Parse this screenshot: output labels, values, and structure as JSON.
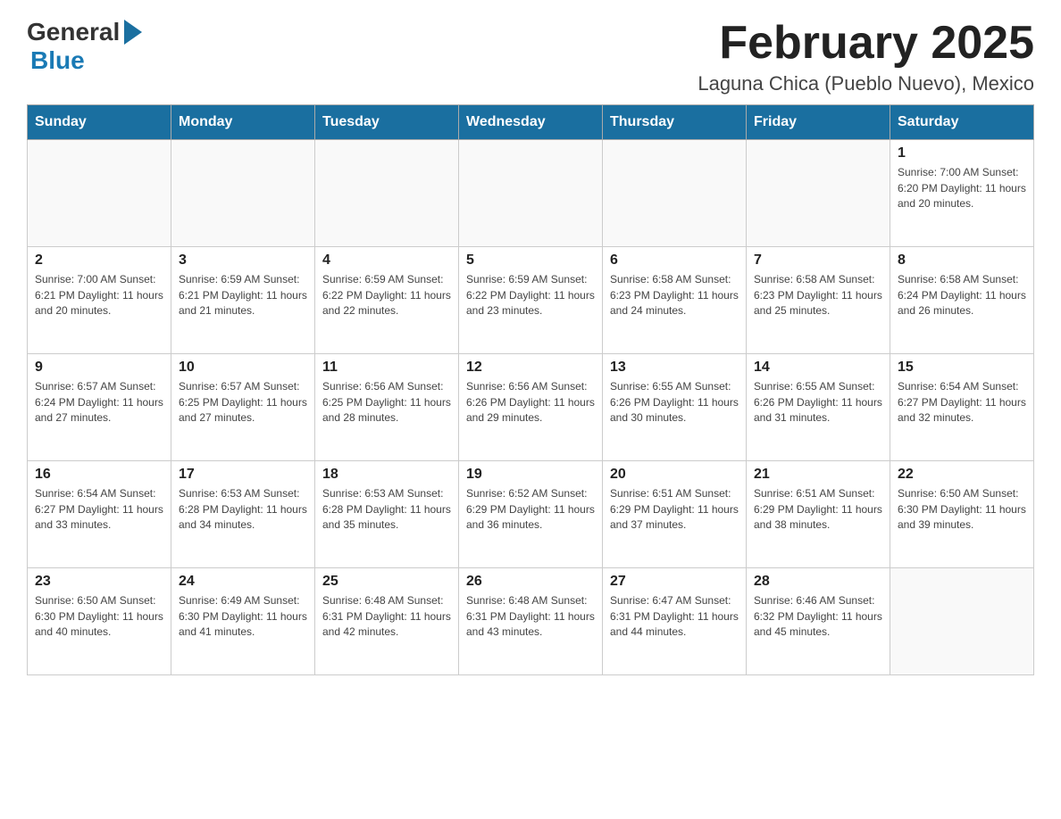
{
  "header": {
    "logo_general": "General",
    "logo_blue": "Blue",
    "month_title": "February 2025",
    "location": "Laguna Chica (Pueblo Nuevo), Mexico"
  },
  "weekdays": [
    "Sunday",
    "Monday",
    "Tuesday",
    "Wednesday",
    "Thursday",
    "Friday",
    "Saturday"
  ],
  "weeks": [
    {
      "days": [
        {
          "number": "",
          "info": "",
          "empty": true
        },
        {
          "number": "",
          "info": "",
          "empty": true
        },
        {
          "number": "",
          "info": "",
          "empty": true
        },
        {
          "number": "",
          "info": "",
          "empty": true
        },
        {
          "number": "",
          "info": "",
          "empty": true
        },
        {
          "number": "",
          "info": "",
          "empty": true
        },
        {
          "number": "1",
          "info": "Sunrise: 7:00 AM\nSunset: 6:20 PM\nDaylight: 11 hours and 20 minutes."
        }
      ]
    },
    {
      "days": [
        {
          "number": "2",
          "info": "Sunrise: 7:00 AM\nSunset: 6:21 PM\nDaylight: 11 hours and 20 minutes."
        },
        {
          "number": "3",
          "info": "Sunrise: 6:59 AM\nSunset: 6:21 PM\nDaylight: 11 hours and 21 minutes."
        },
        {
          "number": "4",
          "info": "Sunrise: 6:59 AM\nSunset: 6:22 PM\nDaylight: 11 hours and 22 minutes."
        },
        {
          "number": "5",
          "info": "Sunrise: 6:59 AM\nSunset: 6:22 PM\nDaylight: 11 hours and 23 minutes."
        },
        {
          "number": "6",
          "info": "Sunrise: 6:58 AM\nSunset: 6:23 PM\nDaylight: 11 hours and 24 minutes."
        },
        {
          "number": "7",
          "info": "Sunrise: 6:58 AM\nSunset: 6:23 PM\nDaylight: 11 hours and 25 minutes."
        },
        {
          "number": "8",
          "info": "Sunrise: 6:58 AM\nSunset: 6:24 PM\nDaylight: 11 hours and 26 minutes."
        }
      ]
    },
    {
      "days": [
        {
          "number": "9",
          "info": "Sunrise: 6:57 AM\nSunset: 6:24 PM\nDaylight: 11 hours and 27 minutes."
        },
        {
          "number": "10",
          "info": "Sunrise: 6:57 AM\nSunset: 6:25 PM\nDaylight: 11 hours and 27 minutes."
        },
        {
          "number": "11",
          "info": "Sunrise: 6:56 AM\nSunset: 6:25 PM\nDaylight: 11 hours and 28 minutes."
        },
        {
          "number": "12",
          "info": "Sunrise: 6:56 AM\nSunset: 6:26 PM\nDaylight: 11 hours and 29 minutes."
        },
        {
          "number": "13",
          "info": "Sunrise: 6:55 AM\nSunset: 6:26 PM\nDaylight: 11 hours and 30 minutes."
        },
        {
          "number": "14",
          "info": "Sunrise: 6:55 AM\nSunset: 6:26 PM\nDaylight: 11 hours and 31 minutes."
        },
        {
          "number": "15",
          "info": "Sunrise: 6:54 AM\nSunset: 6:27 PM\nDaylight: 11 hours and 32 minutes."
        }
      ]
    },
    {
      "days": [
        {
          "number": "16",
          "info": "Sunrise: 6:54 AM\nSunset: 6:27 PM\nDaylight: 11 hours and 33 minutes."
        },
        {
          "number": "17",
          "info": "Sunrise: 6:53 AM\nSunset: 6:28 PM\nDaylight: 11 hours and 34 minutes."
        },
        {
          "number": "18",
          "info": "Sunrise: 6:53 AM\nSunset: 6:28 PM\nDaylight: 11 hours and 35 minutes."
        },
        {
          "number": "19",
          "info": "Sunrise: 6:52 AM\nSunset: 6:29 PM\nDaylight: 11 hours and 36 minutes."
        },
        {
          "number": "20",
          "info": "Sunrise: 6:51 AM\nSunset: 6:29 PM\nDaylight: 11 hours and 37 minutes."
        },
        {
          "number": "21",
          "info": "Sunrise: 6:51 AM\nSunset: 6:29 PM\nDaylight: 11 hours and 38 minutes."
        },
        {
          "number": "22",
          "info": "Sunrise: 6:50 AM\nSunset: 6:30 PM\nDaylight: 11 hours and 39 minutes."
        }
      ]
    },
    {
      "days": [
        {
          "number": "23",
          "info": "Sunrise: 6:50 AM\nSunset: 6:30 PM\nDaylight: 11 hours and 40 minutes."
        },
        {
          "number": "24",
          "info": "Sunrise: 6:49 AM\nSunset: 6:30 PM\nDaylight: 11 hours and 41 minutes."
        },
        {
          "number": "25",
          "info": "Sunrise: 6:48 AM\nSunset: 6:31 PM\nDaylight: 11 hours and 42 minutes."
        },
        {
          "number": "26",
          "info": "Sunrise: 6:48 AM\nSunset: 6:31 PM\nDaylight: 11 hours and 43 minutes."
        },
        {
          "number": "27",
          "info": "Sunrise: 6:47 AM\nSunset: 6:31 PM\nDaylight: 11 hours and 44 minutes."
        },
        {
          "number": "28",
          "info": "Sunrise: 6:46 AM\nSunset: 6:32 PM\nDaylight: 11 hours and 45 minutes."
        },
        {
          "number": "",
          "info": "",
          "empty": true
        }
      ]
    }
  ]
}
